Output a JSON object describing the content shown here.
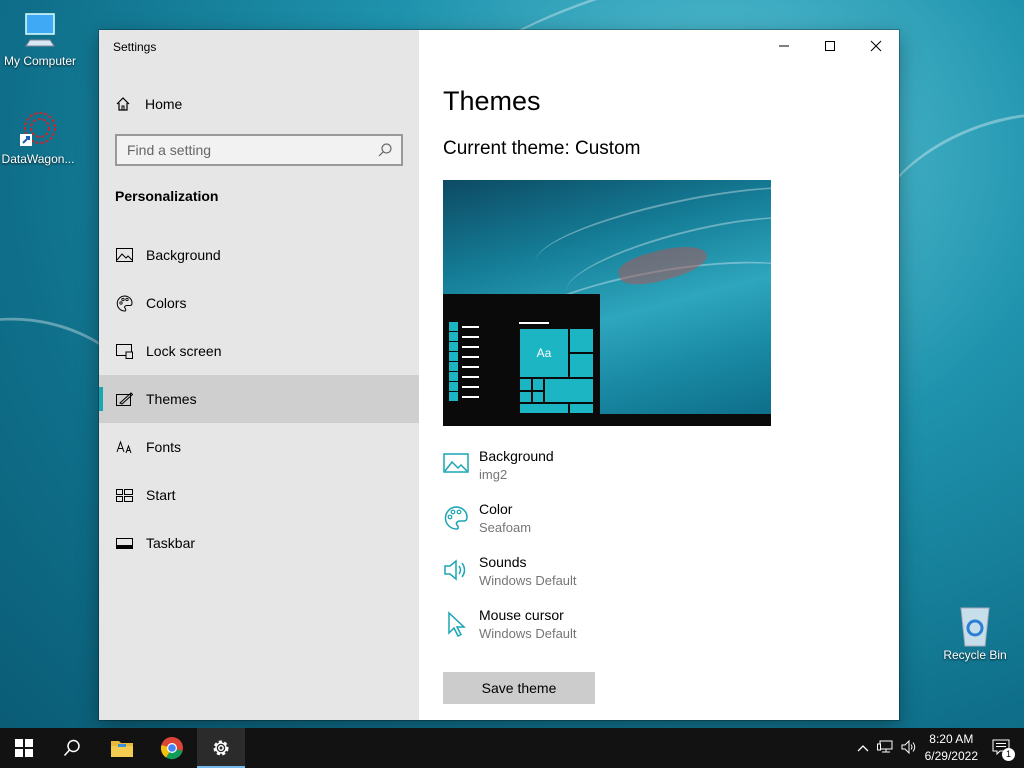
{
  "desktop": {
    "icons": [
      {
        "label": "My Computer",
        "icon": "computer-icon"
      },
      {
        "label": "DataWagon...",
        "icon": "datawagon-shortcut-icon"
      },
      {
        "label": "Recycle Bin",
        "icon": "recycle-bin-icon"
      }
    ]
  },
  "window": {
    "title": "Settings",
    "controls": {
      "minimize": "minimize-icon",
      "maximize": "maximize-icon",
      "close": "close-icon"
    }
  },
  "sidebar": {
    "home_label": "Home",
    "search_placeholder": "Find a setting",
    "section_title": "Personalization",
    "items": [
      {
        "label": "Background",
        "icon": "picture-icon",
        "active": false
      },
      {
        "label": "Colors",
        "icon": "palette-icon",
        "active": false
      },
      {
        "label": "Lock screen",
        "icon": "lock-screen-icon",
        "active": false
      },
      {
        "label": "Themes",
        "icon": "themes-icon",
        "active": true
      },
      {
        "label": "Fonts",
        "icon": "fonts-icon",
        "active": false
      },
      {
        "label": "Start",
        "icon": "start-icon",
        "active": false
      },
      {
        "label": "Taskbar",
        "icon": "taskbar-icon",
        "active": false
      }
    ]
  },
  "main": {
    "heading": "Themes",
    "current_theme": "Current theme: Custom",
    "preview_tile_label": "Aa",
    "theme_items": [
      {
        "name": "Background",
        "value": "img2",
        "icon": "picture-icon"
      },
      {
        "name": "Color",
        "value": "Seafoam",
        "icon": "palette-icon"
      },
      {
        "name": "Sounds",
        "value": "Windows Default",
        "icon": "speaker-icon"
      },
      {
        "name": "Mouse cursor",
        "value": "Windows Default",
        "icon": "cursor-icon"
      }
    ],
    "save_button": "Save theme"
  },
  "taskbar": {
    "time": "8:20 AM",
    "date": "6/29/2022",
    "notification_count": "1",
    "pinned": [
      "start-icon",
      "search-icon",
      "file-explorer-icon",
      "chrome-icon",
      "settings-icon"
    ]
  },
  "colors": {
    "accent": "#1aa5b5",
    "taskbar": "#121212",
    "sidebar": "#e6e6e6"
  }
}
